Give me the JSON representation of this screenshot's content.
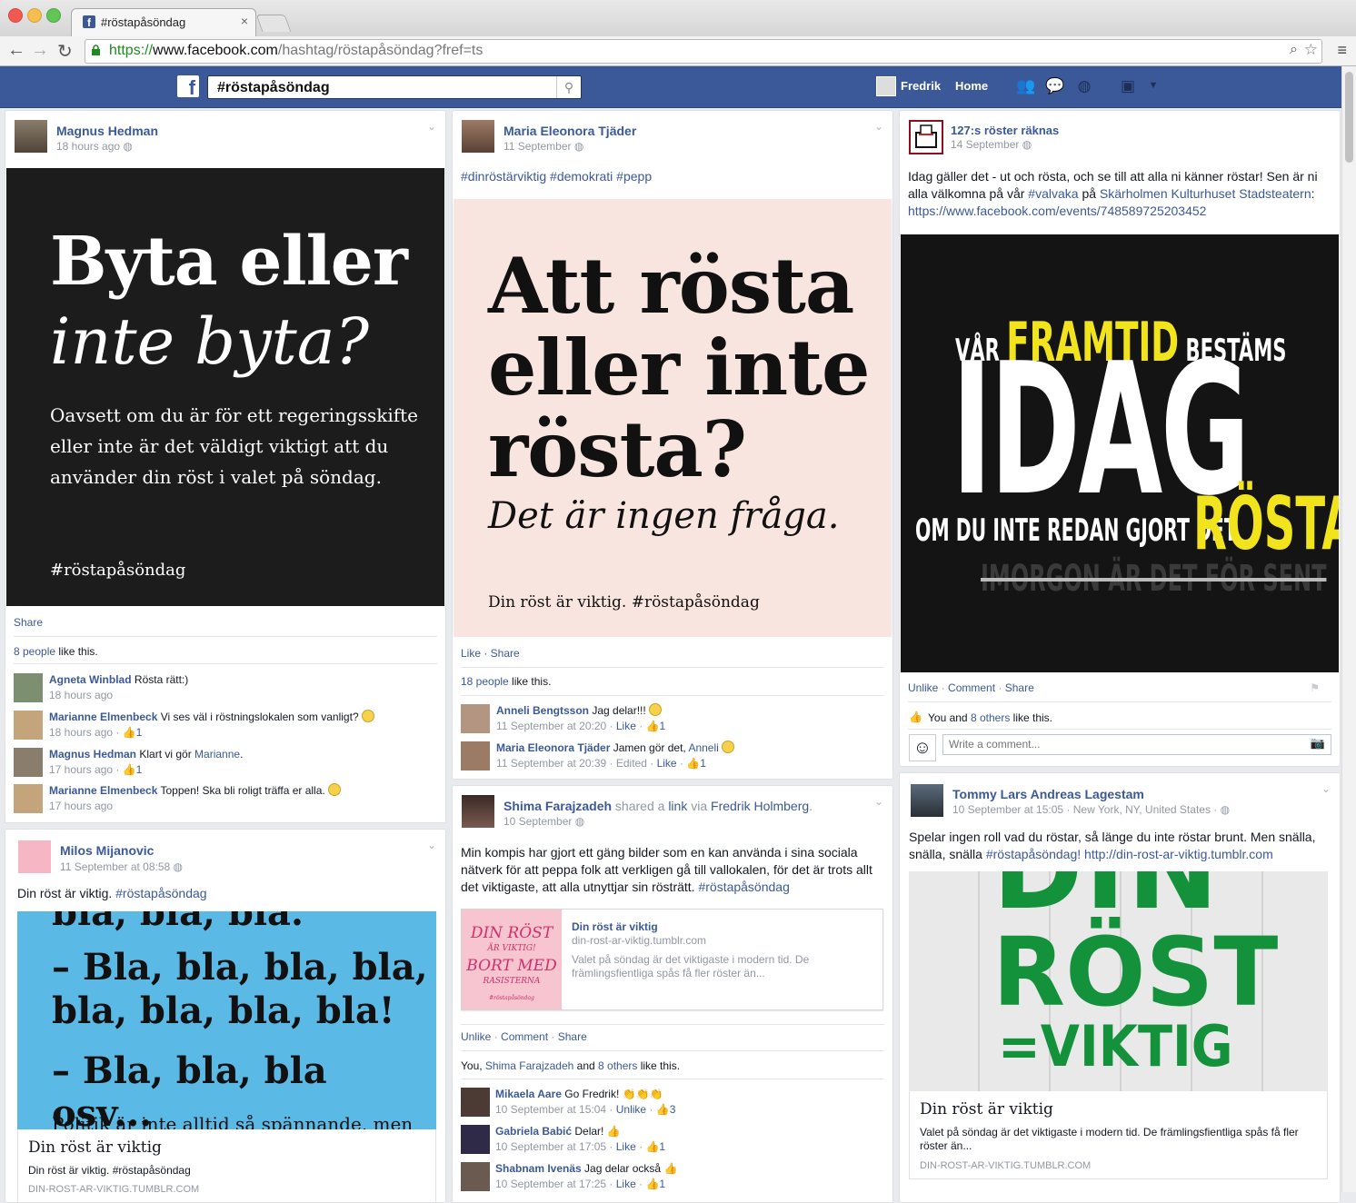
{
  "browser": {
    "tab_title": "#röstapåsöndag",
    "tab_close": "×",
    "url_https": "https://",
    "url_host": "www.facebook.com",
    "url_path": "/hashtag/röstapåsöndag?fref=ts"
  },
  "fb": {
    "logo": "f",
    "search_value": "#röstapåsöndag",
    "user_name": "Fredrik",
    "home_label": "Home"
  },
  "posts": {
    "p1": {
      "author": "Magnus Hedman",
      "time": "18 hours ago",
      "poster": {
        "line1": "Byta eller",
        "line2": "inte byta?",
        "body": [
          "Oavsett om du är för ett regeringsskifte",
          "eller inte är det väldigt viktigt att du",
          "använder din röst i valet på söndag."
        ],
        "hashtag": "#röstapåsöndag"
      },
      "share": "Share",
      "likes_count": "8 people",
      "likes_suffix": " like this.",
      "comments": [
        {
          "name": "Agneta Winblad",
          "text": " Rösta rätt:)",
          "meta": "18 hours ago"
        },
        {
          "name": "Marianne Elmenbeck",
          "text": " Vi ses väl i röstningslokalen som vanligt?",
          "meta": "18 hours ago · ",
          "likes": "1"
        },
        {
          "name": "Magnus Hedman",
          "text": " Klart vi gör ",
          "mention": "Marianne",
          "tail": ".",
          "meta": "17 hours ago · ",
          "likes": "1"
        },
        {
          "name": "Marianne Elmenbeck",
          "text": " Toppen! Ska bli roligt träffa er alla.",
          "meta": "17 hours ago"
        }
      ]
    },
    "p2": {
      "author": "Milos Mijanovic",
      "time": "11 September at 08:58",
      "text": "Din röst är viktig. ",
      "hashtag": "#röstapåsöndag",
      "poster": {
        "l0": "bla, bla, bla.",
        "l1": "– Bla, bla, bla, bla,",
        "l2": "bla, bla, bla, bla!",
        "l3": "– Bla, bla, bla osv...",
        "l4": "Politik är inte alltid så spännande, men"
      },
      "link_title": "Din röst är viktig",
      "link_desc": "Din röst är viktig. #röstapåsöndag",
      "link_domain": "DIN-ROST-AR-VIKTIG.TUMBLR.COM"
    },
    "p3": {
      "author": "Maria Eleonora Tjäder",
      "time": "11 September",
      "tags": "#dinröstärviktig #demokrati #pepp",
      "poster": {
        "l1": "Att rösta",
        "l2": "eller inte",
        "l3": "rösta?",
        "l4": "Det är ingen fråga.",
        "l5": "Din röst är viktig. #röstapåsöndag"
      },
      "actions": "Like · Share",
      "likes_count": "18 people",
      "likes_suffix": " like this.",
      "comments": [
        {
          "name": "Anneli Bengtsson",
          "text": " Jag delar!!!",
          "meta": "11 September at 20:20 · ",
          "like": "Like",
          "likes": "1"
        },
        {
          "name": "Maria Eleonora Tjäder",
          "text": " Jamen gör det, ",
          "mention": "Anneli",
          "meta": "11 September at 20:39 · Edited · ",
          "like": "Like",
          "likes": "1"
        }
      ]
    },
    "p4": {
      "author": "Shima Farajzadeh",
      "shared": " shared a ",
      "link_word": "link",
      "via": " via ",
      "via_name": "Fredrik Holmberg",
      "time": "10 September",
      "text": "Min kompis har gjort ett gäng bilder som en kan använda i sina sociala nätverk för att peppa folk att verkligen gå till vallokalen, för det är trots allt det viktigaste, att alla utnyttjar sin rösträtt. ",
      "hashtag": "#röstapåsöndag",
      "thumb": {
        "a": "DIN RÖST",
        "b": "ÄR VIKTIG!",
        "c": "BORT MED",
        "d": "RASISTERNA",
        "e": "#röstapåsöndag"
      },
      "link_title": "Din röst är viktig",
      "link_domain": "din-rost-ar-viktig.tumblr.com",
      "link_desc": "Valet på söndag är det viktigaste i modern tid. De främlingsfientliga spås få fler röster än...",
      "actions": [
        "Unlike",
        "Comment",
        "Share"
      ],
      "likes_you": "You, ",
      "likes_name": "Shima Farajzadeh",
      "likes_and": " and ",
      "likes_others": "8 others",
      "likes_suffix": " like this.",
      "comments": [
        {
          "name": "Mikaela Aare",
          "text": " Go Fredrik!",
          "meta": "10 September at 15:04 · ",
          "like": "Unlike",
          "likes": "3"
        },
        {
          "name": "Gabriela Babić",
          "text": " Delar!",
          "meta": "10 September at 17:05 · ",
          "like": "Like",
          "likes": "1"
        },
        {
          "name": "Shabnam Ivenäs",
          "text": " Jag delar också",
          "meta": "10 September at 17:25 · ",
          "like": "Like",
          "likes": "1"
        }
      ]
    },
    "p5": {
      "author": "127:s röster räknas",
      "time": "14 September",
      "text_a": "Idag gäller det - ut och rösta, och se till att alla ni känner röstar! Sen är ni alla välkomna på vår ",
      "tag_a": "#valvaka",
      "text_b": " på ",
      "tag_b": "Skärholmen Kulturhuset Stadsteatern",
      "text_c": ":",
      "url": "https://www.facebook.com/events/748589725203452",
      "poster": {
        "var": "VÅR ",
        "framtid": "FRAMTID",
        "bestams": " BESTÄMS",
        "idag": "IDAG",
        "om": "OM DU INTE REDAN GJORT DET",
        "rosta": "RÖSTA",
        "imorgon": "IMORGON ÄR DET FÖR SENT"
      },
      "actions": [
        "Unlike",
        "Comment",
        "Share"
      ],
      "likes_you": "You and ",
      "likes_others": "8 others",
      "likes_suffix": " like this.",
      "comment_placeholder": "Write a comment..."
    },
    "p6": {
      "author": "Tommy Lars Andreas Lagestam",
      "time": "10 September at 15:05 · New York, NY, United States · ",
      "text": "Spelar ingen roll vad du röstar, så länge du inte röstar brunt. Men snälla, snälla, snälla ",
      "hashtag": "#röstapåsöndag!",
      "url": "http://din-rost-ar-viktig.tumblr.com",
      "poster": {
        "a": "DIN",
        "b": "RÖST",
        "c": "=VIKTIG"
      },
      "link_title": "Din röst är viktig",
      "link_desc": "Valet på söndag är det viktigaste i modern tid. De främlingsfientliga spås få fler röster än...",
      "link_domain": "DIN-ROST-AR-VIKTIG.TUMBLR.COM"
    }
  }
}
